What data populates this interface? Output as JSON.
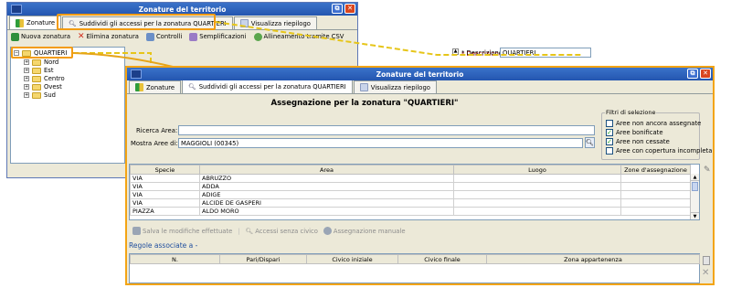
{
  "back_window": {
    "title": "Zonature del territorio",
    "tabs": [
      {
        "label": "Zonature"
      },
      {
        "label": "Suddividi gli accessi per la zonatura QUARTIERI"
      },
      {
        "label": "Visualizza riepilogo"
      }
    ],
    "toolbar": [
      {
        "label": "Nuova zonatura"
      },
      {
        "label": "Elimina zonatura"
      },
      {
        "label": "Controlli"
      },
      {
        "label": "Semplificazioni"
      },
      {
        "label": "Allineamento tramite CSV"
      }
    ],
    "tree": {
      "root": "QUARTIERI",
      "children": [
        "Nord",
        "Est",
        "Centro",
        "Ovest",
        "Sud"
      ]
    },
    "form": {
      "descrizione_label": "* Descrizione",
      "descrizione_value": "QUARTIERI"
    }
  },
  "front_window": {
    "title": "Zonature del territorio",
    "tabs": [
      {
        "label": "Zonature"
      },
      {
        "label": "Suddividi gli accessi per la zonatura QUARTIERI"
      },
      {
        "label": "Visualizza riepilogo"
      }
    ],
    "heading": "Assegnazione per la zonatura \"QUARTIERI\"",
    "ricerca_label": "Ricerca Area:",
    "ricerca_value": "",
    "mostra_label": "Mostra Aree di:",
    "mostra_value": "MAGGIOLI (00345)",
    "filters": {
      "title": "Filtri di selezione",
      "items": [
        {
          "label": "Aree non ancora assegnate",
          "checked": false
        },
        {
          "label": "Aree bonificate",
          "checked": true
        },
        {
          "label": "Aree non cessate",
          "checked": true
        },
        {
          "label": "Aree con copertura incompleta",
          "checked": false
        }
      ]
    },
    "table": {
      "columns": [
        "Specie",
        "Area",
        "Luogo",
        "Zone d'assegnazione"
      ],
      "rows": [
        [
          "VIA",
          "ABRUZZO",
          "",
          ""
        ],
        [
          "VIA",
          "ADDA",
          "",
          ""
        ],
        [
          "VIA",
          "ADIGE",
          "",
          ""
        ],
        [
          "VIA",
          "ALCIDE DE GASPERI",
          "",
          ""
        ],
        [
          "PIAZZA",
          "ALDO MORO",
          "",
          ""
        ]
      ]
    },
    "actions": [
      {
        "label": "Salva le modifiche effettuate"
      },
      {
        "label": "Accessi senza civico"
      },
      {
        "label": "Assegnazione manuale"
      }
    ],
    "rules": {
      "title": "Regole associate a -",
      "columns": [
        "N.",
        "Pari/Dispari",
        "Civico iniziale",
        "Civico finale",
        "Zona appartenenza"
      ]
    }
  },
  "colors": {
    "title_bar": "#2456b0",
    "highlight": "#f39c12",
    "link_blue": "#1f4e9e"
  }
}
